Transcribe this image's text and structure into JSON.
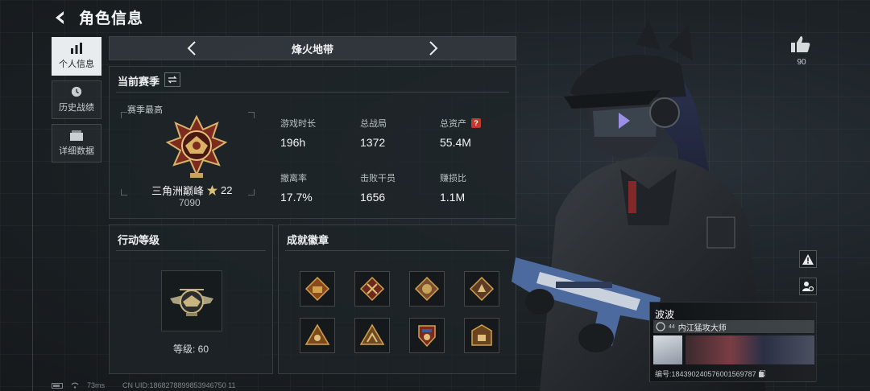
{
  "header": {
    "title": "角色信息"
  },
  "sidebar": {
    "items": [
      {
        "label": "个人信息",
        "icon": "bar-chart-icon",
        "active": true
      },
      {
        "label": "历史战绩",
        "icon": "clock-icon",
        "active": false
      },
      {
        "label": "详细数据",
        "icon": "folder-icon",
        "active": false
      }
    ]
  },
  "season": {
    "name": "烽火地带"
  },
  "stats": {
    "title": "当前赛季",
    "best_label": "赛季最高",
    "rank": {
      "name": "三角洲巅峰",
      "stars": "22",
      "score": "7090"
    },
    "items": [
      {
        "label": "游戏时长",
        "value": "196h"
      },
      {
        "label": "总战局",
        "value": "1372"
      },
      {
        "label": "总资产",
        "value": "55.4M"
      },
      {
        "label": "撤离率",
        "value": "17.7%"
      },
      {
        "label": "击败干员",
        "value": "1656"
      },
      {
        "label": "赚损比",
        "value": "1.1M"
      }
    ],
    "help_glyph": "?"
  },
  "level": {
    "title": "行动等级",
    "text": "等级: 60"
  },
  "achievements": {
    "title": "成就徽章",
    "badges": [
      "badge-1",
      "badge-2",
      "badge-3",
      "badge-4",
      "badge-5",
      "badge-6",
      "badge-7",
      "badge-8"
    ]
  },
  "like": {
    "count": "90"
  },
  "card": {
    "name": "波波",
    "level": "44",
    "title": "内江猛攻大师",
    "id": "编号:184390240576001569787"
  },
  "footer": {
    "ping": "73ms",
    "uid": "CN UID:1868278899853946750 11"
  },
  "colors": {
    "accent_gold": "#c9a35a",
    "active_tab": "#e9ecee",
    "help_red": "#c0392b"
  }
}
